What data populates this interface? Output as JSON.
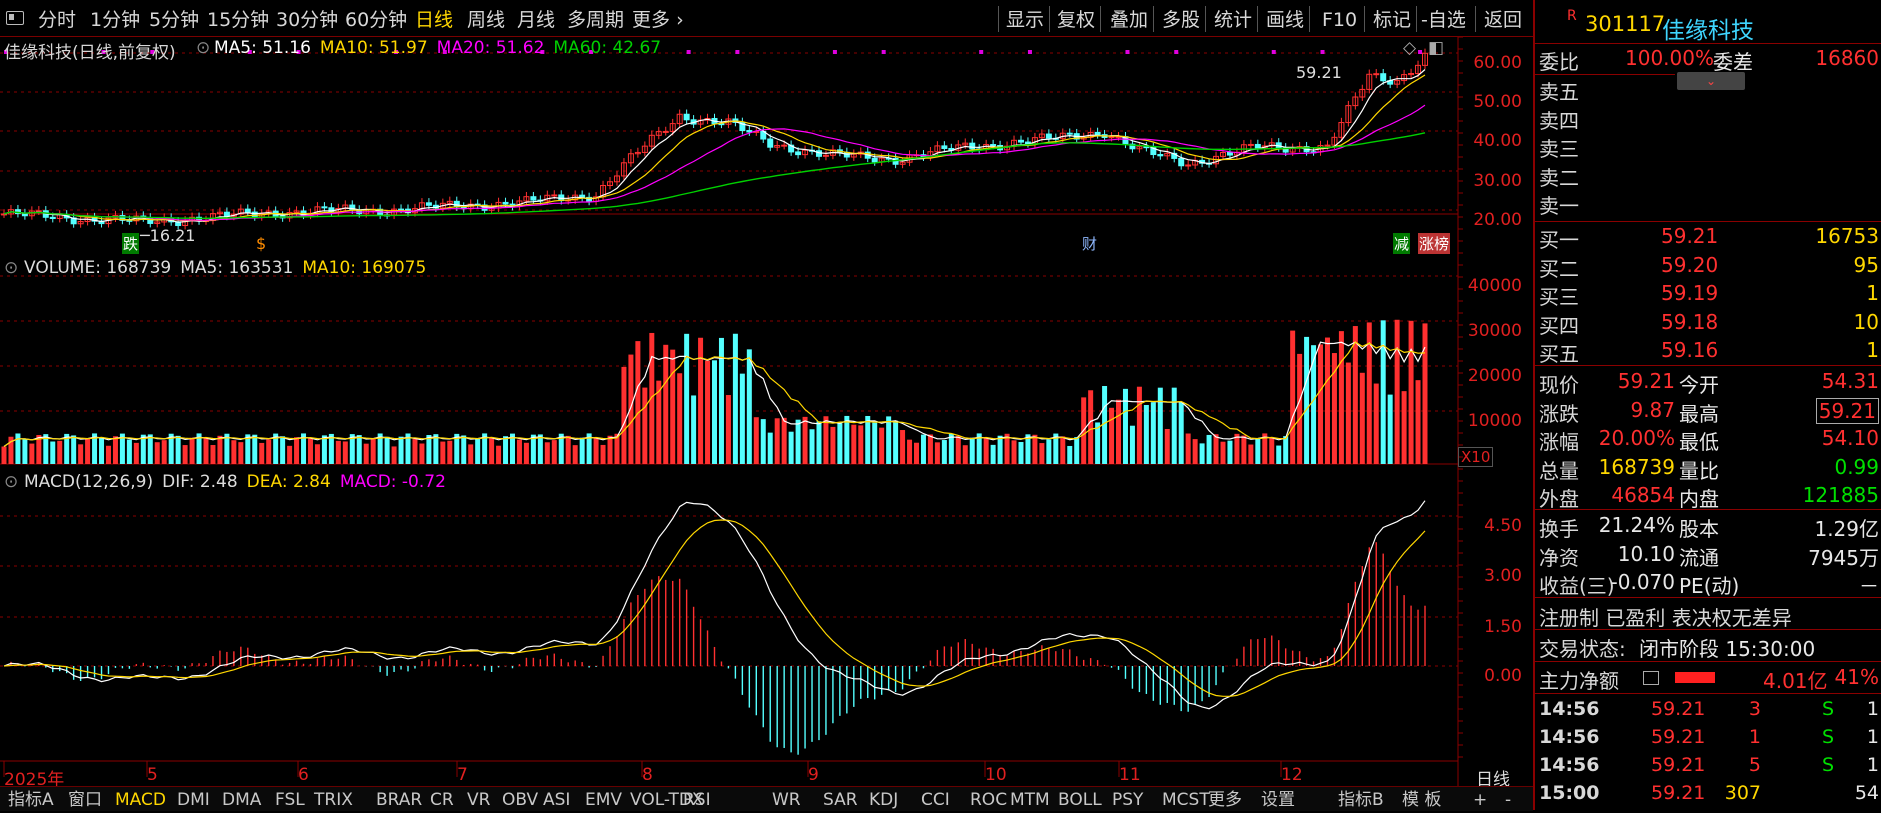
{
  "topbar": {
    "periods": [
      "分时",
      "1分钟",
      "5分钟",
      "15分钟",
      "30分钟",
      "60分钟",
      "日线",
      "周线",
      "月线",
      "多周期",
      "更多"
    ],
    "active_period": "日线",
    "tools": [
      "显示",
      "复权",
      "叠加",
      "多股",
      "统计",
      "画线",
      "F10",
      "标记",
      "-自选",
      "返回"
    ]
  },
  "price_pane": {
    "stock_title": "佳缘科技(日线,前复权)",
    "ma5": "MA5: 51.16",
    "ma10": "MA10: 51.97",
    "ma20": "MA20: 51.62",
    "ma60": "MA60: 42.67",
    "axis": [
      "60.00",
      "50.00",
      "40.00",
      "30.00",
      "20.00"
    ],
    "high_label": "59.21",
    "low_label": "16.21",
    "badges": [
      "跌",
      "$",
      "财",
      "减",
      "涨榜"
    ]
  },
  "volume_pane": {
    "volume": "VOLUME: 168739",
    "ma5": "MA5: 163531",
    "ma10": "MA10: 169075",
    "axis": [
      "40000",
      "30000",
      "20000",
      "10000"
    ],
    "unit": "X10"
  },
  "macd_pane": {
    "title": "MACD(12,26,9)",
    "dif": "DIF: 2.48",
    "dea": "DEA: 2.84",
    "macd": "MACD: -0.72",
    "axis": [
      "4.50",
      "3.00",
      "1.50",
      "0.00"
    ]
  },
  "x_axis": {
    "labels": [
      "2025年",
      "5",
      "6",
      "7",
      "8",
      "9",
      "10",
      "11",
      "12"
    ],
    "period": "日线"
  },
  "bottombar": {
    "items": [
      "指标A",
      "窗口",
      "MACD",
      "DMI",
      "DMA",
      "FSL",
      "TRIX",
      "BRAR",
      "CR",
      "VR",
      "OBV",
      "ASI",
      "EMV",
      "VOL-TDX",
      "RSI",
      "WR",
      "SAR",
      "KDJ",
      "CCI",
      "ROC",
      "MTM",
      "BOLL",
      "PSY",
      "MCST",
      "更多",
      "设置"
    ],
    "active": "MACD",
    "right_items": [
      "指标B",
      "模 板",
      "+",
      "-"
    ]
  },
  "quote": {
    "flag": "R",
    "code": "301117",
    "name": "佳缘科技",
    "weibi_label": "委比",
    "weibi": "100.00%",
    "weicha_label": "委差",
    "weicha": "16860",
    "asks": [
      {
        "label": "卖五"
      },
      {
        "label": "卖四"
      },
      {
        "label": "卖三"
      },
      {
        "label": "卖二"
      },
      {
        "label": "卖一"
      }
    ],
    "bids": [
      {
        "label": "买一",
        "price": "59.21",
        "vol": "16753"
      },
      {
        "label": "买二",
        "price": "59.20",
        "vol": "95"
      },
      {
        "label": "买三",
        "price": "59.19",
        "vol": "1"
      },
      {
        "label": "买四",
        "price": "59.18",
        "vol": "10"
      },
      {
        "label": "买五",
        "price": "59.16",
        "vol": "1"
      }
    ],
    "stats": [
      {
        "l1": "现价",
        "v1": "59.21",
        "l2": "今开",
        "v2": "54.31"
      },
      {
        "l1": "涨跌",
        "v1": "9.87",
        "l2": "最高",
        "v2": "59.21"
      },
      {
        "l1": "涨幅",
        "v1": "20.00%",
        "l2": "最低",
        "v2": "54.10"
      },
      {
        "l1": "总量",
        "v1": "168739",
        "l2": "量比",
        "v2": "0.99"
      },
      {
        "l1": "外盘",
        "v1": "46854",
        "l2": "内盘",
        "v2": "121885"
      }
    ],
    "stats2": [
      {
        "l1": "换手",
        "v1": "21.24%",
        "l2": "股本",
        "v2": "1.29亿"
      },
      {
        "l1": "净资",
        "v1": "10.10",
        "l2": "流通",
        "v2": "7945万"
      },
      {
        "l1": "收益(三)",
        "v1": "-0.070",
        "l2": "PE(动)",
        "v2": "－"
      }
    ],
    "tags": "注册制 已盈利 表决权无差异",
    "status_label": "交易状态:",
    "status": "闭市阶段 15:30:00",
    "main_net_label": "主力净额",
    "main_net": "4.01亿",
    "main_pct": "41%",
    "ticks": [
      {
        "t": "14:56",
        "p": "59.21",
        "v": "3",
        "f": "S",
        "n": "1"
      },
      {
        "t": "14:56",
        "p": "59.21",
        "v": "1",
        "f": "S",
        "n": "1"
      },
      {
        "t": "14:56",
        "p": "59.21",
        "v": "5",
        "f": "S",
        "n": "1"
      },
      {
        "t": "15:00",
        "p": "59.21",
        "v": "307",
        "f": "",
        "n": "54"
      }
    ]
  },
  "colors": {
    "up": "#ff3030",
    "down": "#54ffff",
    "ma5": "#ffffff",
    "ma10": "#ffd700",
    "ma20": "#ff00ff",
    "ma60": "#00d000",
    "grid": "#8a0000"
  }
}
